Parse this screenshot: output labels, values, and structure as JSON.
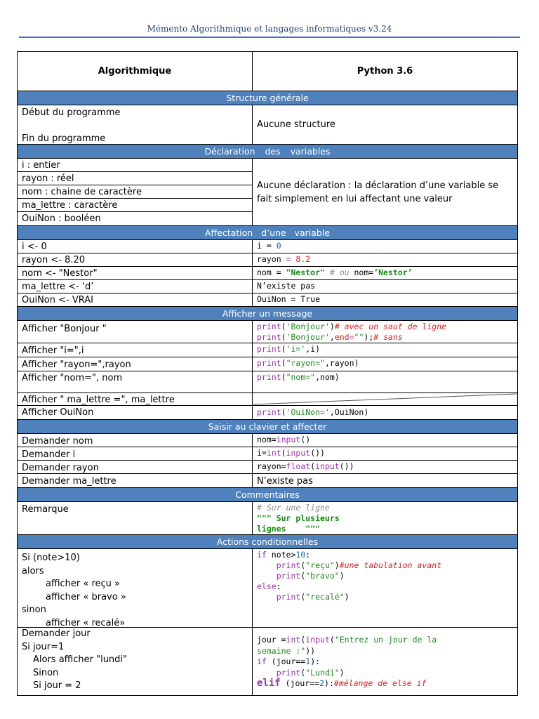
{
  "document_title": "Mémento Algorithmique et langages informatiques v3.24",
  "header": {
    "left": "Algorithmique",
    "right": "Python 3.6"
  },
  "sections": {
    "structure": "Structure générale",
    "declaration": "Déclaration des variables",
    "affectation": "Affectation d’une variable",
    "afficher": "Afficher un message",
    "saisir": "Saisir au clavier et affecter",
    "commentaires": "Commentaires",
    "conditions": "Actions conditionnelles"
  },
  "structure": {
    "left": [
      "Début du programme",
      "",
      "Fin du programme"
    ],
    "right": "Aucune structure"
  },
  "declaration": {
    "left": [
      "i : entier",
      "rayon : réel",
      "nom : chaine de caractère",
      "ma_lettre : caractère",
      "OuiNon : booléen"
    ],
    "right_line1": "Aucune déclaration : la déclaration d’une variable se",
    "right_line2": "fait simplement en lui affectant une valeur"
  },
  "affectation": {
    "left": [
      "i <- 0",
      "rayon <- 8.20",
      "nom <- \"Nestor\"",
      "ma_lettre <- ‘d’",
      "OuiNon  <- VRAI"
    ],
    "py_i": [
      "i = ",
      "0"
    ],
    "py_rayon": [
      "rayon ",
      "= ",
      "8.2"
    ],
    "py_nom": [
      "nom = ",
      "\"Nestor\"",
      " # ou ",
      "nom=",
      "’Nestor’"
    ],
    "py_lettre": "N’existe pas",
    "py_ouinon": "OuiNon = True"
  },
  "afficher": {
    "left": [
      "Afficher \"Bonjour \"",
      "Afficher \"i=\",i",
      "Afficher \"rayon=\",rayon",
      "Afficher \"nom=\", nom",
      "Afficher \" ma_lettre =\", ma_lettre",
      "Afficher OuiNon"
    ],
    "py_bonjour1": [
      "print",
      "(",
      "'Bonjour'",
      ")",
      "# avec un saut de ligne"
    ],
    "py_bonjour2": [
      "print",
      "(",
      "'Bonjour'",
      ",",
      "end",
      "=",
      "\"\"",
      ");",
      "# sans"
    ],
    "py_i": [
      "print",
      "(",
      "'i='",
      ",i)"
    ],
    "py_rayon": [
      "print",
      "(",
      "\"rayon=\"",
      ",rayon)"
    ],
    "py_nom": [
      "print",
      "(",
      "\"nom=\"",
      ",nom)"
    ],
    "py_ouinon": [
      "print",
      "(",
      "'OuiNon='",
      ",OuiNon)"
    ]
  },
  "saisir": {
    "left": [
      "Demander  nom",
      "Demander  i",
      "Demander  rayon",
      "Demander  ma_lettre"
    ],
    "py_nom": [
      "nom=",
      "input",
      "()"
    ],
    "py_i": [
      "i=",
      "int",
      "(",
      "input",
      "())"
    ],
    "py_rayon": [
      "rayon=",
      "float",
      "(",
      "input",
      "())"
    ],
    "py_lettre": "N’existe pas"
  },
  "commentaires": {
    "left": "Remarque",
    "py_line1": "# Sur une ligne",
    "py_line2": "\"\"\" Sur plusieurs",
    "py_line3": "lignes    \"\"\""
  },
  "conditions1": {
    "left": [
      "Si (note>10)",
      "alors",
      "afficher « reçu »",
      "afficher « bravo »",
      "sinon",
      "afficher « recalé»"
    ],
    "py_l1": [
      "if",
      " note>",
      "10",
      ":"
    ],
    "py_l2": [
      "    print",
      "(",
      "\"reçu\"",
      ")",
      "#une tabulation avant"
    ],
    "py_l3": [
      "    print",
      "(",
      "\"bravo\"",
      ")"
    ],
    "py_l4": [
      "else",
      ":"
    ],
    "py_l5": [
      "    print",
      "(",
      "\"recalé\"",
      ")"
    ]
  },
  "conditions2": {
    "left": [
      "Demander jour",
      "Si jour=1",
      "Alors afficher \"lundi\"",
      "Sinon",
      "Si jour = 2"
    ],
    "py_l1": [
      "jour =",
      "int",
      "(",
      "input",
      "(",
      "\"Entrez un jour de la"
    ],
    "py_l2": [
      "semaine :\"",
      "))"
    ],
    "py_l3": [
      "if",
      " (jour==",
      "1",
      "):"
    ],
    "py_l4": [
      "    print",
      "(",
      "\"Lundi\"",
      ")"
    ],
    "py_l5": [
      "elif",
      " (jour==",
      "2",
      "):",
      "#mélange de else if"
    ]
  }
}
